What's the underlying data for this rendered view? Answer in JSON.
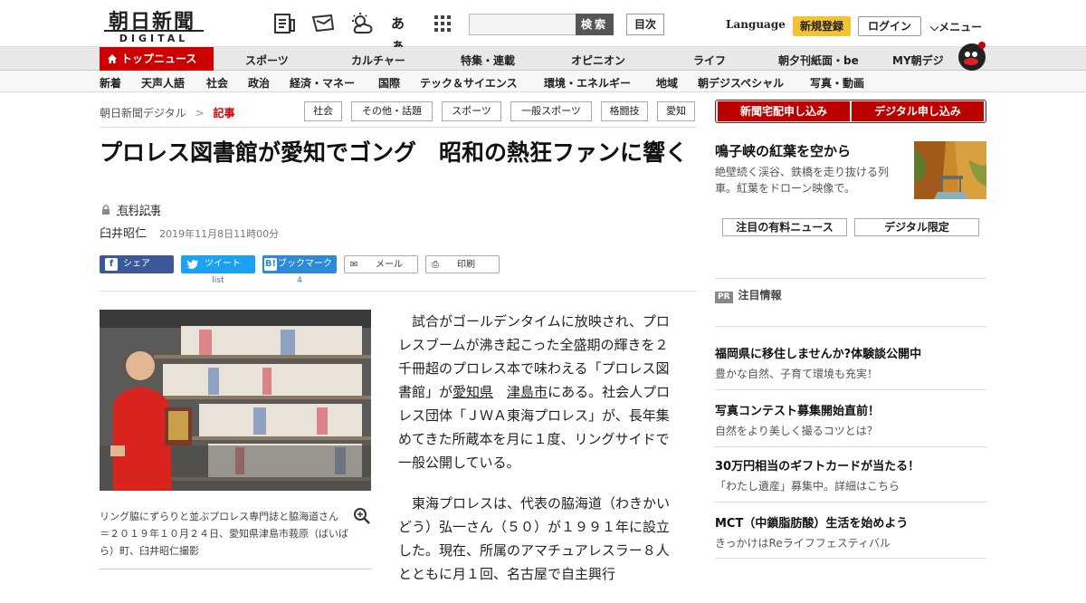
{
  "header": {
    "logo_ja": "朝日新聞",
    "logo_en": "DIGITAL",
    "search_button": "検索",
    "toc_button": "目次",
    "language": "Language",
    "signup": "新規登録",
    "login": "ログイン",
    "menu": "メニュー",
    "font_size_glyph": "あぁ"
  },
  "nav_primary": {
    "top_news": "トップニュース",
    "items": [
      "スポーツ",
      "カルチャー",
      "特集・連載",
      "オピニオン",
      "ライフ",
      "朝夕刊紙面・be",
      "MY朝デジ"
    ]
  },
  "nav_secondary": {
    "items": [
      "新着",
      "天声人語",
      "社会",
      "政治",
      "経済・マネー",
      "国際",
      "テック＆サイエンス",
      "環境・エネルギー",
      "地域",
      "朝デジスペシャル",
      "写真・動画"
    ]
  },
  "breadcrumb": {
    "root": "朝日新聞デジタル",
    "separator": ">",
    "current": "記事"
  },
  "tags": [
    "社会",
    "その他・話題",
    "スポーツ",
    "一般スポーツ",
    "格闘技",
    "愛知"
  ],
  "article": {
    "title": "プロレス図書館が愛知でゴング　昭和の熱狂ファンに響く",
    "paid_label": "有料記事",
    "author": "臼井昭仁",
    "date": "2019年11月8日11時00分",
    "share": {
      "facebook": "シェア",
      "twitter": "ツイート",
      "twitter_count": "list",
      "hatena": "ブックマーク",
      "hatena_count": "4",
      "mail": "メール",
      "print": "印刷"
    },
    "photo_caption": "リング脇にずらりと並ぶプロレス専門誌と脇海道さん＝２０１９年１０月２４日、愛知県津島市莪原（ばいばら）町、臼井昭仁撮影",
    "p1_a": "試合がゴールデンタイムに放映され、プロレスブームが沸き起こった全盛期の輝きを２千冊超のプロレス本で味わえる「プロレス図書館」が",
    "p1_link1": "愛知県",
    "p1_link2": "津島市",
    "p1_b": "にある。社会人プロレス団体「ＪＷＡ東海プロレス」が、長年集めてきた所蔵本を月に１度、リングサイドで一般公開している。",
    "p2": "東海プロレスは、代表の脇海道（わきかいどう）弘一さん（５０）が１９９１年に設立した。現在、所属のアマチュアレスラー８人とともに月１回、名古屋で自主興行"
  },
  "sidebar": {
    "btn_newspaper": "新聞宅配申し込み",
    "btn_digital": "デジタル申し込み",
    "feature_title": "鳴子峡の紅葉を空から",
    "feature_text": "絶壁続く渓谷、鉄橋を走り抜ける列車。紅葉をドローン映像で。",
    "tab_paid": "注目の有料ニュース",
    "tab_digital": "デジタル限定",
    "pr_badge": "PR",
    "pr_title": "注目情報",
    "ads": [
      {
        "title": "福岡県に移住しませんか?体験談公開中",
        "sub": "豊かな自然、子育て環境も充実！"
      },
      {
        "title": "写真コンテスト募集開始直前！",
        "sub": "自然をより美しく撮るコツとは？"
      },
      {
        "title": "30万円相当のギフトカードが当たる！",
        "sub": "「わたし遺産」募集中。詳細はこちら"
      },
      {
        "title": "MCT（中鎖脂肪酸）生活を始めよう",
        "sub": "きっかけはReライフフェスティバル"
      }
    ]
  },
  "colors": {
    "brand_red": "#cc0000",
    "facebook": "#3b5998",
    "twitter": "#1da1f2",
    "hatena": "#2c8ad8",
    "signup_yellow": "#f4c235"
  }
}
